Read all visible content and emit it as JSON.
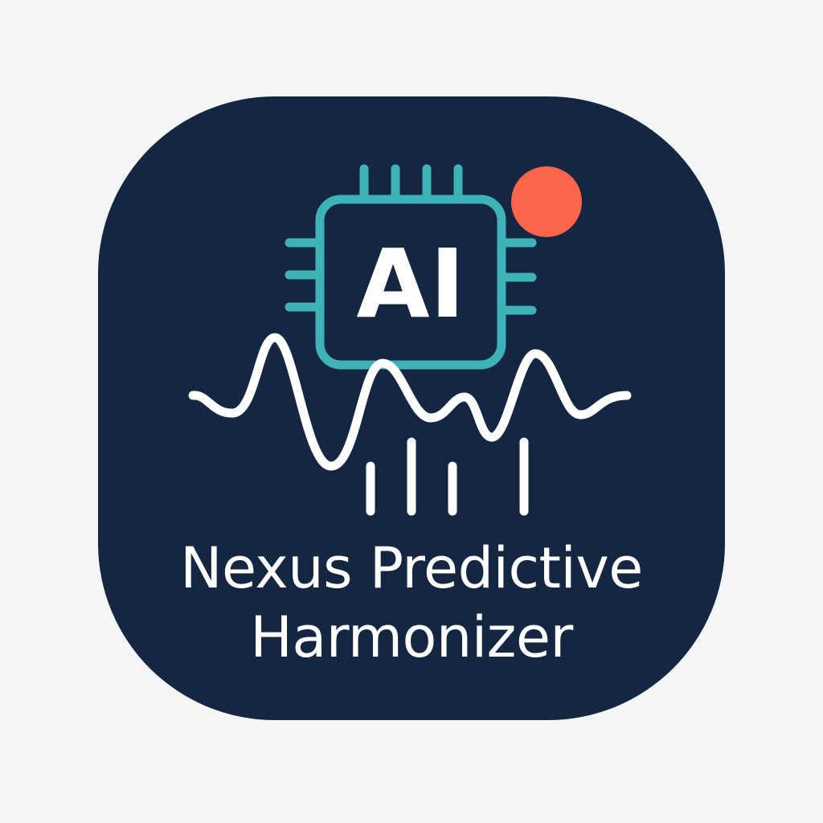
{
  "app": {
    "name_line1": "Nexus Predictive",
    "name_line2": "Harmonizer",
    "chip_label": "AI"
  },
  "icons": {
    "chip": "cpu-chip-icon",
    "waveform": "sound-wave-icon",
    "bars": "level-bars-icon",
    "notification": "notification-dot-icon"
  },
  "colors": {
    "background": "#f4f5f6",
    "icon_background": "#142641",
    "chip_accent": "#3db3b8",
    "wave": "#ffffff",
    "notification_dot": "#fb6549",
    "text": "#ffffff"
  }
}
